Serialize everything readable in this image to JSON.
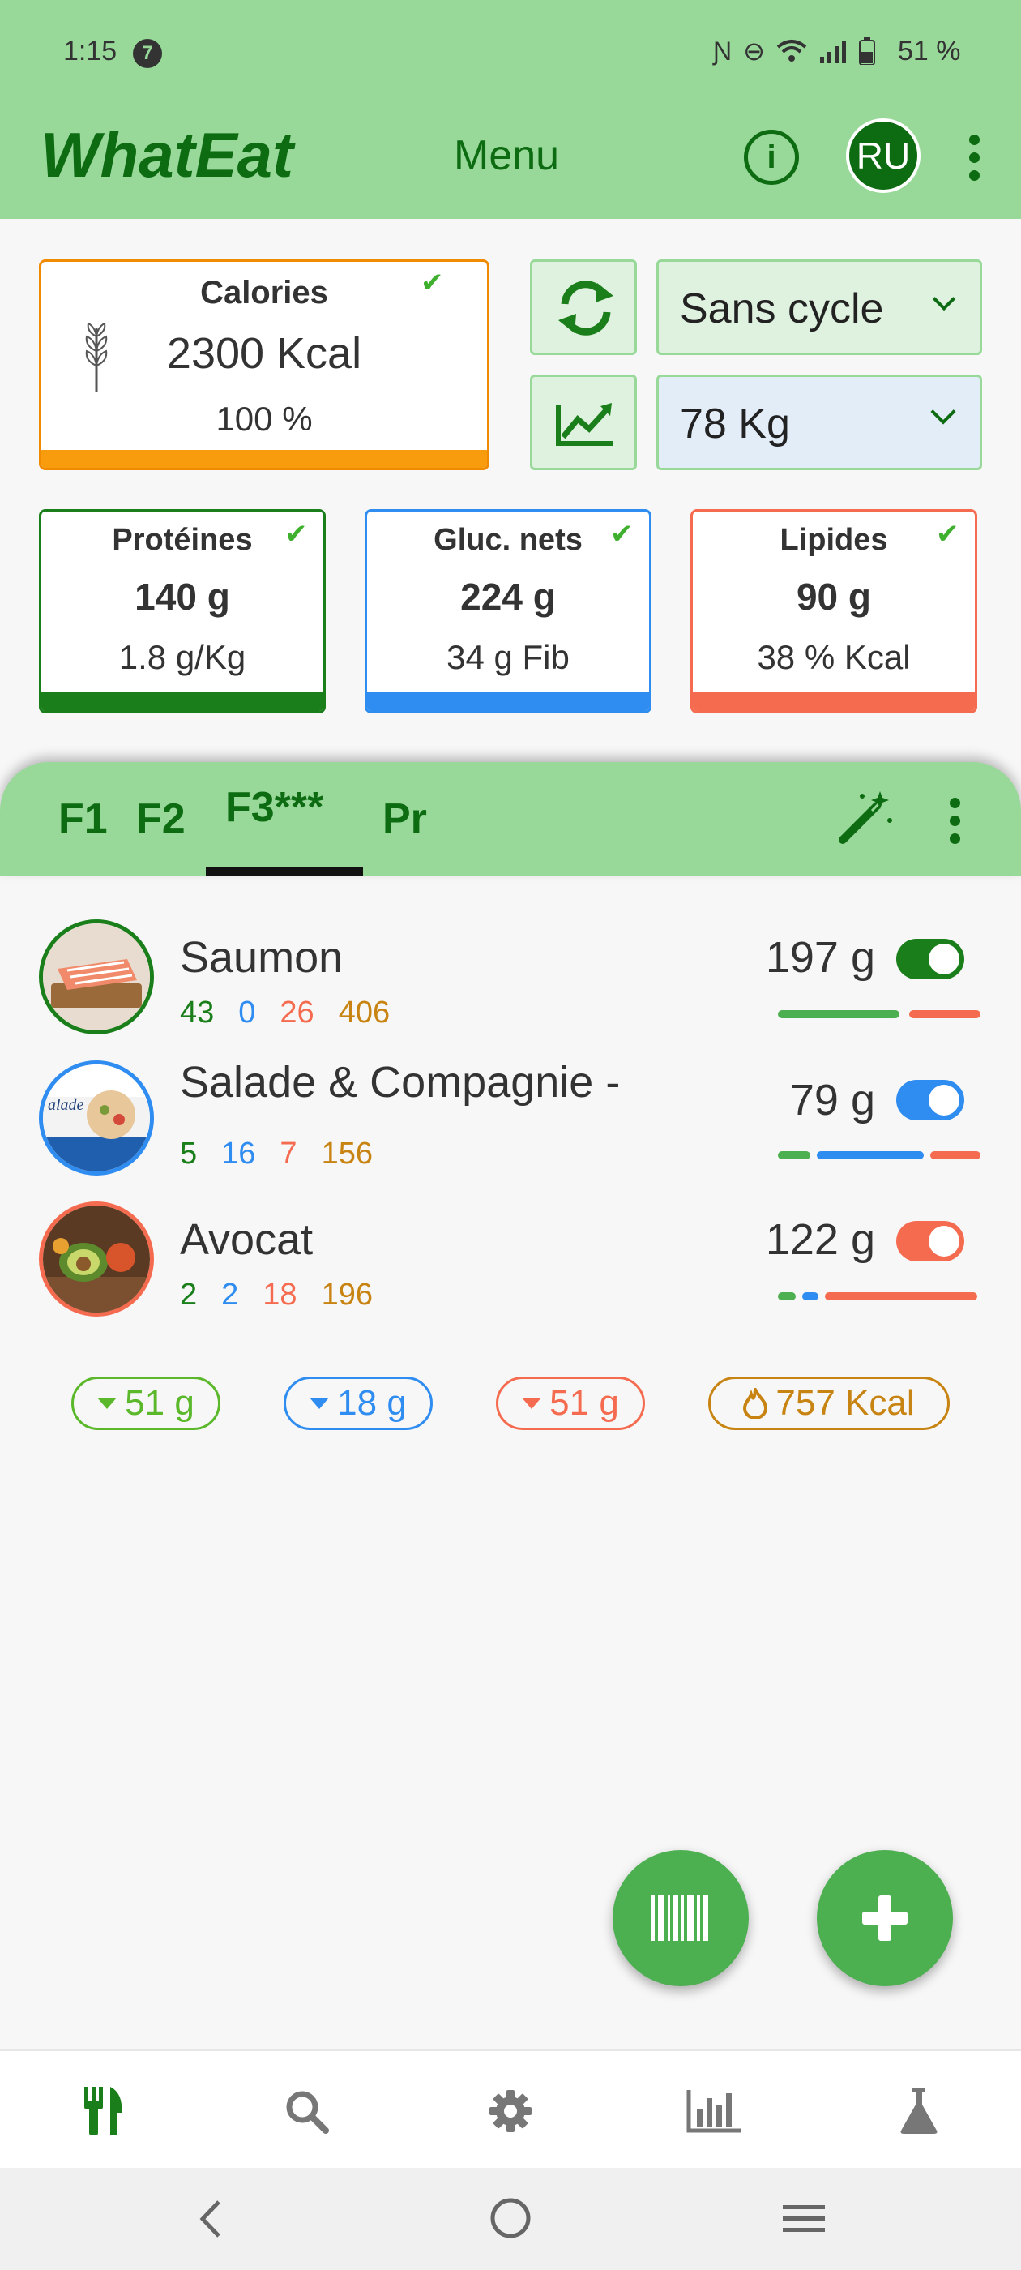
{
  "status": {
    "time": "1:15",
    "badge": "7",
    "battery": "51 %"
  },
  "app": {
    "title": "WhatEat",
    "menu_label": "Menu",
    "avatar_initials": "RU"
  },
  "calories": {
    "title": "Calories",
    "value": "2300 Kcal",
    "percent": "100 %"
  },
  "cycle_select": {
    "value": "Sans cycle"
  },
  "weight_select": {
    "value": "78 Kg"
  },
  "macros": [
    {
      "title": "Protéines",
      "value": "140 g",
      "sub": "1.8 g/Kg",
      "color": "#1a7f1a"
    },
    {
      "title": "Gluc. nets",
      "value": "224 g",
      "sub": "34 g Fib",
      "color": "#2f8cf0"
    },
    {
      "title": "Lipides",
      "value": "90 g",
      "sub": "38 % Kcal",
      "color": "#f56b4f"
    }
  ],
  "meal_tabs": [
    {
      "label": "F1",
      "active": false
    },
    {
      "label": "F2",
      "active": false
    },
    {
      "label": "F3***",
      "active": true
    },
    {
      "label": "Pr",
      "active": false
    }
  ],
  "foods": [
    {
      "name": "Saumon",
      "weight": "197 g",
      "protein": "43",
      "carbs": "0",
      "fat": "26",
      "kcal": "406",
      "toggle_color": "#1a7f1a",
      "border_color": "#1a7f1a",
      "enabled": true
    },
    {
      "name": "Salade & Compagnie -",
      "weight": "79 g",
      "protein": "5",
      "carbs": "16",
      "fat": "7",
      "kcal": "156",
      "toggle_color": "#2f8cf0",
      "border_color": "#2f8cf0",
      "enabled": true
    },
    {
      "name": "Avocat",
      "weight": "122 g",
      "protein": "2",
      "carbs": "2",
      "fat": "18",
      "kcal": "196",
      "toggle_color": "#f56b4f",
      "border_color": "#f56b4f",
      "enabled": true
    }
  ],
  "remaining": {
    "protein": "51 g",
    "carbs": "18 g",
    "fat": "51 g",
    "kcal": "757 Kcal"
  },
  "colors": {
    "app_bar": "#98d99a",
    "primary_dark": "#0d6b12",
    "protein": "#1a7f1a",
    "carbs": "#2f8cf0",
    "fat": "#f56b4f",
    "kcal": "#c88412",
    "fab": "#4caf50"
  },
  "icons": [
    "refresh-icon",
    "trend-chart-icon",
    "magic-wand-icon",
    "barcode-icon",
    "plus-icon",
    "fork-knife-icon",
    "search-icon",
    "gear-icon",
    "bar-chart-icon",
    "flask-icon"
  ]
}
